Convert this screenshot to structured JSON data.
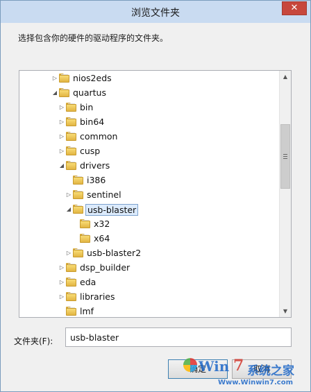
{
  "window": {
    "title": "浏览文件夹",
    "close_glyph": "✕"
  },
  "instruction": "选择包含你的硬件的驱动程序的文件夹。",
  "tree": {
    "items": [
      {
        "label": "nios2eds",
        "level": 1,
        "expander": "collapsed",
        "selected": false
      },
      {
        "label": "quartus",
        "level": 1,
        "expander": "expanded",
        "selected": false
      },
      {
        "label": "bin",
        "level": 2,
        "expander": "collapsed",
        "selected": false
      },
      {
        "label": "bin64",
        "level": 2,
        "expander": "collapsed",
        "selected": false
      },
      {
        "label": "common",
        "level": 2,
        "expander": "collapsed",
        "selected": false
      },
      {
        "label": "cusp",
        "level": 2,
        "expander": "collapsed",
        "selected": false
      },
      {
        "label": "drivers",
        "level": 2,
        "expander": "expanded",
        "selected": false
      },
      {
        "label": "i386",
        "level": 3,
        "expander": "none",
        "selected": false
      },
      {
        "label": "sentinel",
        "level": 3,
        "expander": "collapsed",
        "selected": false
      },
      {
        "label": "usb-blaster",
        "level": 3,
        "expander": "expanded",
        "selected": true
      },
      {
        "label": "x32",
        "level": 4,
        "expander": "none",
        "selected": false
      },
      {
        "label": "x64",
        "level": 4,
        "expander": "none",
        "selected": false
      },
      {
        "label": "usb-blaster2",
        "level": 3,
        "expander": "collapsed",
        "selected": false
      },
      {
        "label": "dsp_builder",
        "level": 2,
        "expander": "collapsed",
        "selected": false
      },
      {
        "label": "eda",
        "level": 2,
        "expander": "collapsed",
        "selected": false
      },
      {
        "label": "libraries",
        "level": 2,
        "expander": "collapsed",
        "selected": false
      },
      {
        "label": "lmf",
        "level": 2,
        "expander": "none",
        "selected": false
      }
    ],
    "scroll_up_glyph": "▲",
    "scroll_down_glyph": "▼"
  },
  "folder_field": {
    "label": "文件夹(F):",
    "value": "usb-blaster"
  },
  "buttons": {
    "ok": "确定",
    "cancel": "取消"
  },
  "watermark": {
    "brand": "Win",
    "number": "7",
    "cn": "系统之家",
    "url": "Www.Winwin7.com"
  },
  "colors": {
    "title_bar": "#c9dbf1",
    "close": "#c7473c",
    "selection": "#dcebfc",
    "folder": "#f8dc76"
  }
}
